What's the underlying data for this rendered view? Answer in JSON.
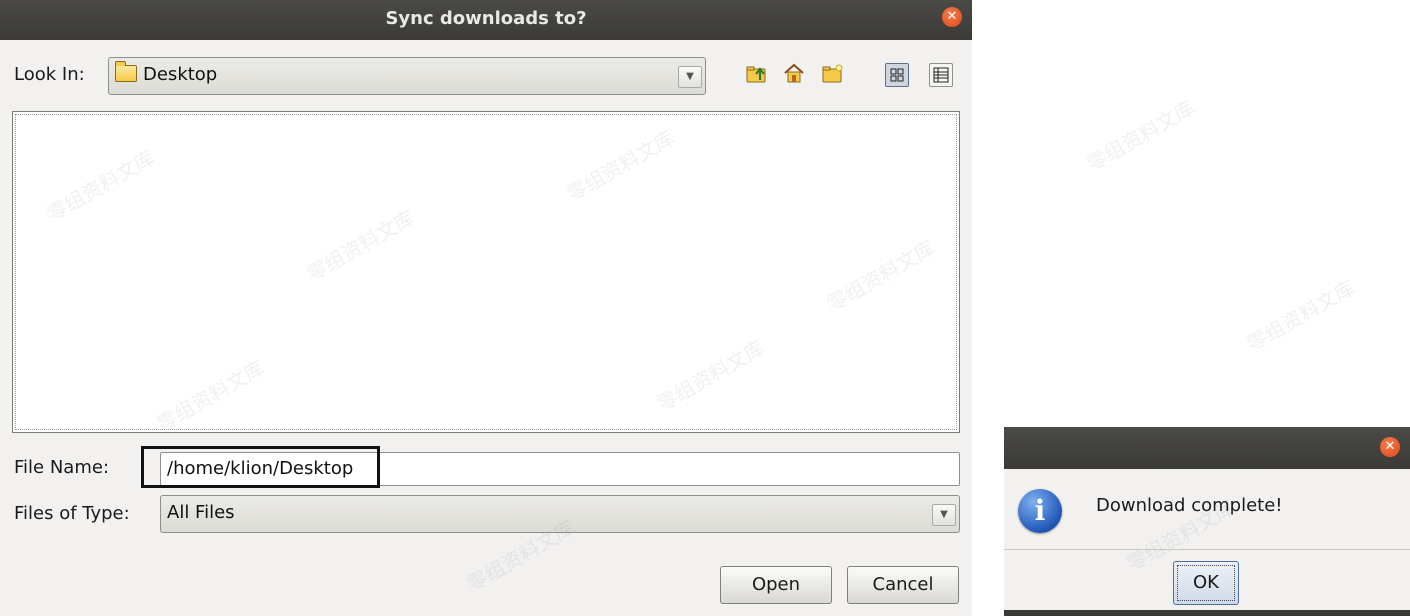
{
  "chooser": {
    "title": "Sync downloads to?",
    "close_icon": "close-icon",
    "look_in_label": "Look In:",
    "look_in_value": "Desktop",
    "toolbar_icons": [
      "up-folder-icon",
      "home-icon",
      "new-folder-icon",
      "list-view-icon",
      "details-view-icon"
    ],
    "file_name_label": "File Name:",
    "file_name_value": "/home/klion/Desktop",
    "files_of_type_label": "Files of Type:",
    "files_of_type_value": "All Files",
    "open_label": "Open",
    "cancel_label": "Cancel"
  },
  "message_dialog": {
    "title": "",
    "icon": "info-icon",
    "message": "Download complete!",
    "ok_label": "OK"
  },
  "watermark": "零组资料文库",
  "colors": {
    "titlebar": "#3f3e3a",
    "close_button": "#e9541f",
    "dialog_bg": "#f2f1f0",
    "info_icon": "#2a62c4"
  }
}
